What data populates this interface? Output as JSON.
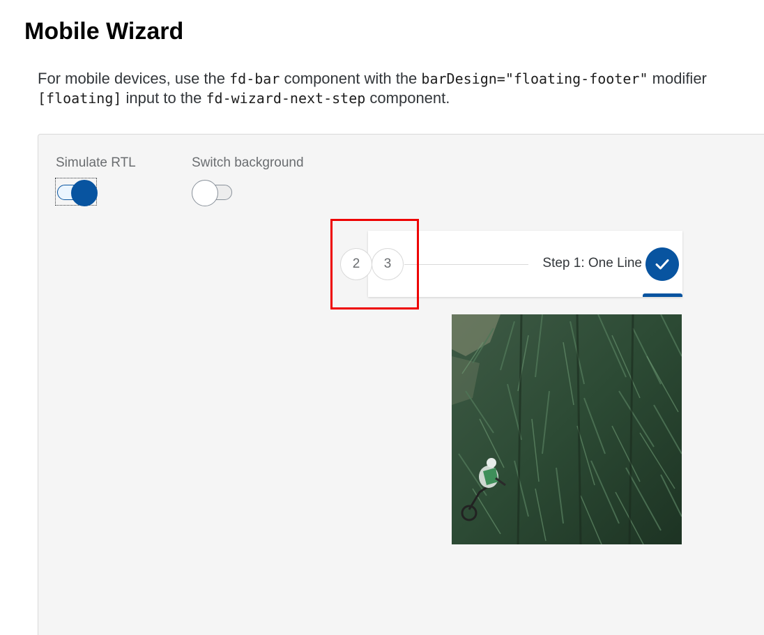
{
  "page": {
    "title": "Mobile Wizard"
  },
  "description": {
    "text_1": "For mobile devices, use the ",
    "code_1": "fd-bar",
    "text_2": " component with the ",
    "code_2": "barDesign=\"floating-footer\"",
    "text_3": " modifier",
    "code_3": "[floating]",
    "text_4": " input to the ",
    "code_4": "fd-wizard-next-step",
    "text_5": " component."
  },
  "controls": {
    "simulate_rtl": {
      "label": "Simulate RTL",
      "checked": true
    },
    "switch_background": {
      "label": "Switch background",
      "checked": false
    }
  },
  "wizard": {
    "steps": [
      {
        "label": "2",
        "state": "upcoming"
      },
      {
        "label": "3",
        "state": "upcoming"
      }
    ],
    "current_step": {
      "label": "Step 1: One Line",
      "state": "completed",
      "icon": "checkmark-icon"
    }
  },
  "content": {
    "image_subject": "forest-mountain-biker-image"
  },
  "colors": {
    "accent": "#0854a0",
    "highlight": "#ee0000",
    "container_bg": "#f5f5f5"
  }
}
